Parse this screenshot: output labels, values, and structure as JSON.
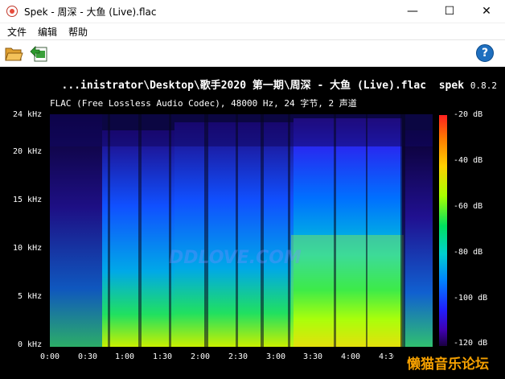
{
  "window": {
    "title": "Spek - 周深 - 大鱼 (Live).flac",
    "minimize": "—",
    "maximize": "☐",
    "close": "✕"
  },
  "menu": [
    "文件",
    "编辑",
    "帮助"
  ],
  "toolbar": {
    "open_icon": "folder-open-icon",
    "save_icon": "save-image-icon",
    "help_label": "?"
  },
  "header": {
    "path": "...inistrator\\Desktop\\歌手2020 第一期\\周深 - 大鱼 (Live).flac",
    "app": "spek",
    "version": "0.8.2",
    "info": "FLAC (Free Lossless Audio Codec), 48000 Hz, 24 字节, 2 声道"
  },
  "freq_axis": [
    "24 kHz",
    "20 kHz",
    "15 kHz",
    "10 kHz",
    "5 kHz",
    "0 kHz"
  ],
  "time_axis": [
    "0:00",
    "0:30",
    "1:00",
    "1:30",
    "2:00",
    "2:30",
    "3:00",
    "3:30",
    "4:00",
    "4:30"
  ],
  "db_axis": [
    "-20 dB",
    "-40 dB",
    "-60 dB",
    "-80 dB",
    "-100 dB",
    "-120 dB"
  ],
  "watermark": "DDLOVE.COM",
  "forum_mark": "懒猫音乐论坛",
  "colors": {
    "background": "#000000",
    "loud": "#ffd000",
    "quiet": "#1a0040"
  }
}
